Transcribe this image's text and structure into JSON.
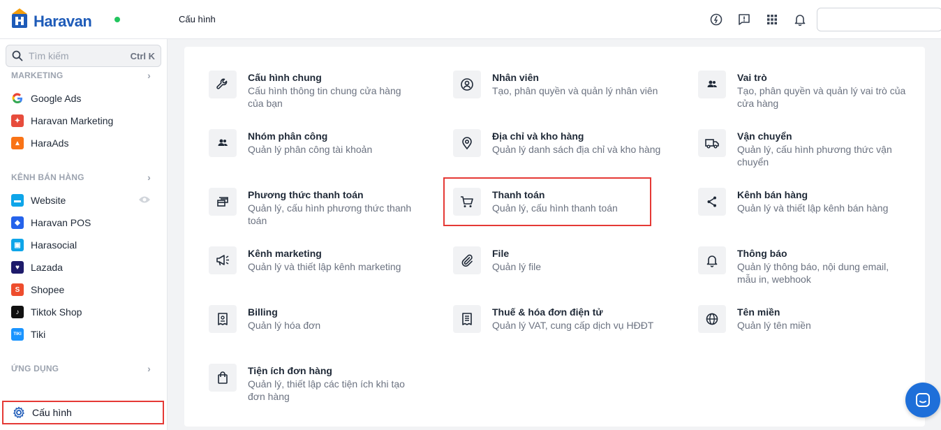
{
  "app": {
    "logo_text": "Haravan"
  },
  "header": {
    "page_title": "Cấu hình"
  },
  "top_icons": [
    "support-icon",
    "feedback-icon",
    "apps-grid-icon",
    "bell-icon"
  ],
  "sidebar": {
    "search_placeholder": "Tìm kiếm",
    "search_shortcut": "Ctrl K",
    "sections": [
      {
        "label": "MARKETING",
        "items": [
          {
            "label": "Google Ads",
            "icon": "google-icon",
            "color": "#ffffff"
          },
          {
            "label": "Haravan Marketing",
            "icon": "haravan-marketing-icon",
            "color": "#e74c3c"
          },
          {
            "label": "HaraAds",
            "icon": "haraads-icon",
            "color": "#f97316"
          }
        ]
      },
      {
        "label": "KÊNH BÁN HÀNG",
        "items": [
          {
            "label": "Website",
            "icon": "website-icon",
            "color": "#0ea5e9"
          },
          {
            "label": "Haravan POS",
            "icon": "pos-icon",
            "color": "#2563eb"
          },
          {
            "label": "Harasocial",
            "icon": "harasocial-icon",
            "color": "#0ea5e9"
          },
          {
            "label": "Lazada",
            "icon": "lazada-icon",
            "color": "#1e1b6b"
          },
          {
            "label": "Shopee",
            "icon": "shopee-icon",
            "color": "#ee4d2d"
          },
          {
            "label": "Tiktok Shop",
            "icon": "tiktok-icon",
            "color": "#111111"
          },
          {
            "label": "Tiki",
            "icon": "tiki-icon",
            "color": "#1a94ff",
            "badge": "TIKI"
          }
        ]
      },
      {
        "label": "ỨNG DỤNG",
        "items": []
      }
    ],
    "settings_label": "Cấu hình"
  },
  "settings_tiles": [
    {
      "title": "Cấu hình chung",
      "desc": "Cấu hình thông tin chung cửa hàng của bạn",
      "icon": "wrench-icon"
    },
    {
      "title": "Nhân viên",
      "desc": "Tạo, phân quyền và quản lý nhân viên",
      "icon": "user-circle-icon"
    },
    {
      "title": "Vai trò",
      "desc": "Tạo, phân quyền và quản lý vai trò của cửa hàng",
      "icon": "users-icon"
    },
    {
      "title": "Nhóm phân công",
      "desc": "Quản lý phân công tài khoản",
      "icon": "group-icon"
    },
    {
      "title": "Địa chỉ và kho hàng",
      "desc": "Quản lý danh sách địa chỉ và kho hàng",
      "icon": "location-pin-icon"
    },
    {
      "title": "Vận chuyển",
      "desc": "Quản lý, cấu hình phương thức vận chuyển",
      "icon": "truck-icon"
    },
    {
      "title": "Phương thức thanh toán",
      "desc": "Quản lý, cấu hình phương thức thanh toán",
      "icon": "payment-method-icon"
    },
    {
      "title": "Thanh toán",
      "desc": "Quản lý, cấu hình thanh toán",
      "icon": "cart-icon"
    },
    {
      "title": "Kênh bán hàng",
      "desc": "Quản lý và thiết lập kênh bán hàng",
      "icon": "share-icon"
    },
    {
      "title": "Kênh marketing",
      "desc": "Quản lý và thiết lập kênh marketing",
      "icon": "megaphone-icon"
    },
    {
      "title": "File",
      "desc": "Quản lý file",
      "icon": "paperclip-icon"
    },
    {
      "title": "Thông báo",
      "desc": "Quản lý thông báo, nội dung email, mẫu in, webhook",
      "icon": "bell-icon"
    },
    {
      "title": "Billing",
      "desc": "Quản lý hóa đơn",
      "icon": "receipt-icon"
    },
    {
      "title": "Thuế & hóa đơn điện tử",
      "desc": "Quản lý VAT, cung cấp dịch vụ HĐĐT",
      "icon": "invoice-icon"
    },
    {
      "title": "Tên miền",
      "desc": "Quản lý tên miền",
      "icon": "globe-icon"
    },
    {
      "title": "Tiện ích đơn hàng",
      "desc": "Quản lý, thiết lập các tiện ích khi tạo đơn hàng",
      "icon": "shopping-bag-icon"
    }
  ],
  "colors": {
    "highlight": "#e53935",
    "brand": "#1e5bb8",
    "chat": "#1e6fd9"
  }
}
